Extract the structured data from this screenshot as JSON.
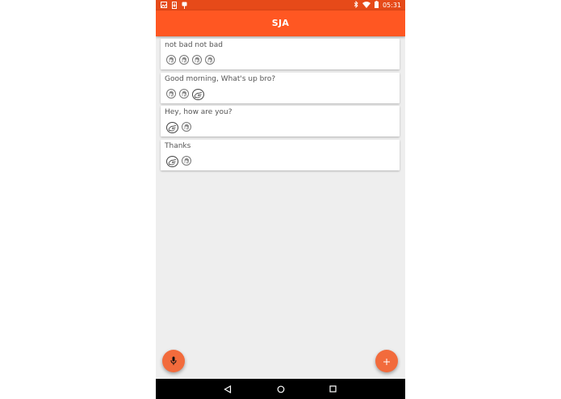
{
  "status_bar": {
    "time": "05:31",
    "left_icons": [
      "image-icon",
      "phone-download-icon",
      "pin-icon"
    ],
    "right_icons": [
      "bluetooth-icon",
      "wifi-icon",
      "battery-icon"
    ]
  },
  "app_bar": {
    "title": "SJA"
  },
  "messages": [
    {
      "text": "not bad not bad",
      "signs": [
        "hand-sign-icon",
        "hand-sign-icon",
        "hand-sign-icon",
        "hand-sign-icon"
      ],
      "big_index": -1
    },
    {
      "text": "Good morning, What's up bro?",
      "signs": [
        "hand-sign-icon",
        "hand-sign-icon",
        "hand-sign-icon"
      ],
      "big_index": 2
    },
    {
      "text": "Hey, how are you?",
      "signs": [
        "hand-sign-icon",
        "hand-sign-icon"
      ],
      "big_index": 0
    },
    {
      "text": "Thanks",
      "signs": [
        "hand-sign-icon",
        "hand-sign-icon"
      ],
      "big_index": 0
    }
  ],
  "fabs": {
    "mic_icon": "microphone-icon",
    "add_icon": "plus-icon"
  },
  "colors": {
    "status_bar": "#e64a19",
    "app_bar": "#ff5722",
    "fab": "#f26b3c",
    "background": "#eeeeee"
  },
  "nav_bar": {
    "icons": [
      "back-icon",
      "home-icon",
      "recents-icon"
    ]
  }
}
